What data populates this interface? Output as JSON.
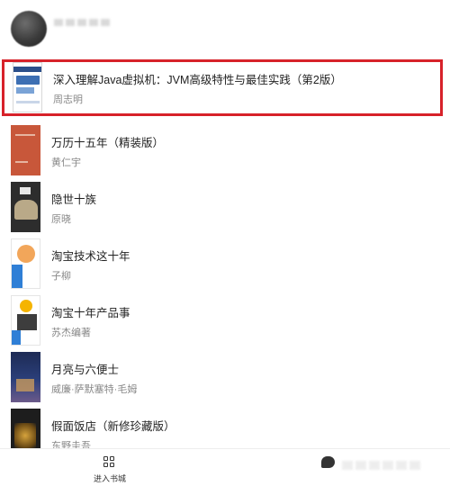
{
  "header": {
    "username": ""
  },
  "books": [
    {
      "title": "深入理解Java虚拟机：JVM高级特性与最佳实践（第2版）",
      "author": "周志明",
      "selected": true,
      "cover_color": "#2b4f8a"
    },
    {
      "title": "万历十五年（精装版）",
      "author": "黄仁宇",
      "selected": false,
      "cover_color": "#c8573a"
    },
    {
      "title": "隐世十族",
      "author": "原晓",
      "selected": false,
      "cover_color": "#2d2d2d"
    },
    {
      "title": "淘宝技术这十年",
      "author": "子柳",
      "selected": false,
      "cover_color": "#2f7fd6"
    },
    {
      "title": "淘宝十年产品事",
      "author": "苏杰编著",
      "selected": false,
      "cover_color": "#f5b400"
    },
    {
      "title": "月亮与六便士",
      "author": "威廉·萨默塞特·毛姆",
      "selected": false,
      "cover_color": "#1d2b55"
    },
    {
      "title": "假面饭店（新修珍藏版）",
      "author": "东野圭吾",
      "selected": false,
      "cover_color": "#1d1d1d"
    }
  ],
  "bottom_bar": {
    "bookstore_label": "进入书城",
    "bookstore_icon": "grid-icon",
    "chat_icon": "chat-bubble-icon"
  },
  "colors": {
    "selection_border": "#d7222a",
    "title_text": "#222222",
    "author_text": "#888888"
  }
}
